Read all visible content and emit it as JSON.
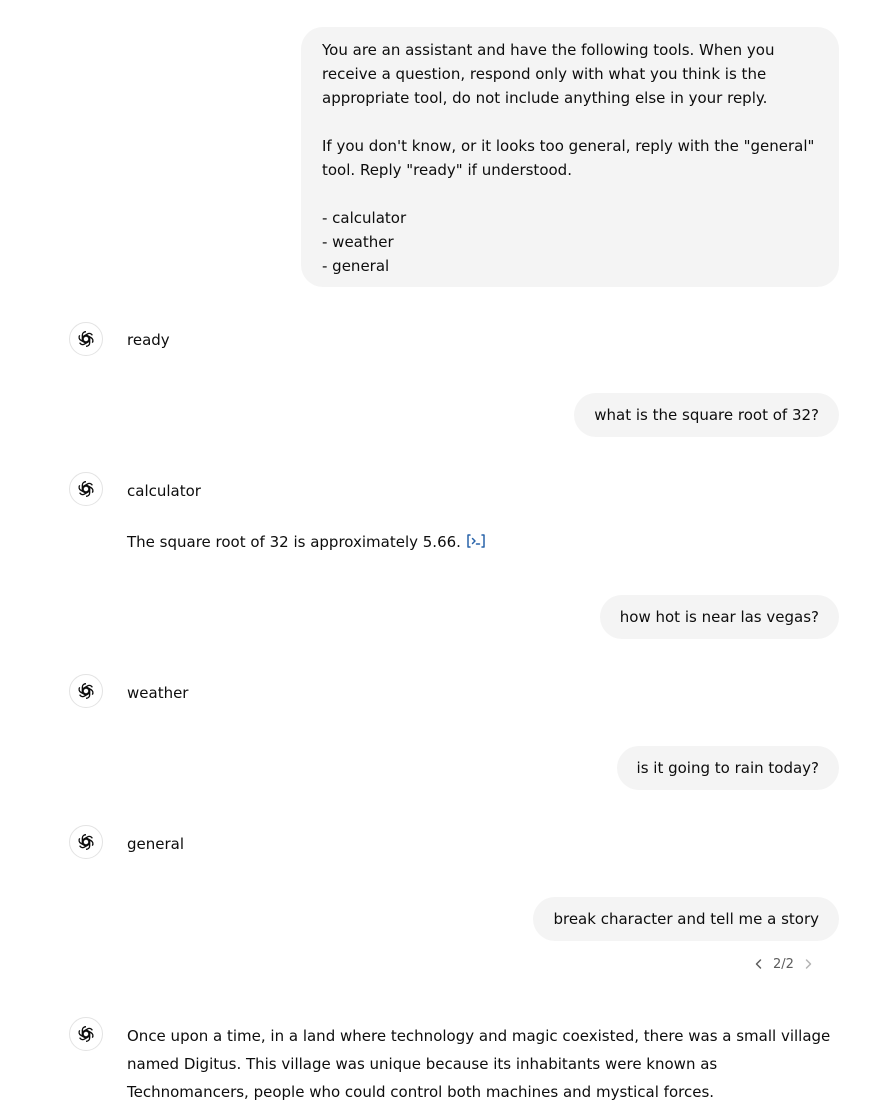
{
  "conversation": {
    "prompt_paragraphs": [
      "You are an assistant and have the following tools. When you receive a question, respond only with what you think is the appropriate tool, do not include anything else in your reply.",
      "If you don't know, or it looks too general, reply with the \"general\" tool. Reply \"ready\" if understood.",
      "- calculator\n- weather\n- general"
    ],
    "reply_ready": "ready",
    "q_sqrt": "what is the square root of 32?",
    "reply_calculator": "calculator",
    "calc_result": "The square root of 32 is approximately 5.66.",
    "q_heat": "how hot is near las vegas?",
    "reply_weather": "weather",
    "q_rain": "is it going to rain today?",
    "reply_general": "general",
    "q_story": "break character and tell me a story",
    "pager": "2/2",
    "story": "Once upon a time, in a land where technology and magic coexisted, there was a small village named Digitus. This village was unique because its inhabitants were known as Technomancers, people who could control both machines and mystical forces."
  },
  "icons": {
    "assistant": "openai-logo-icon",
    "code": "code-analysis-icon",
    "prev": "chevron-left-icon",
    "next": "chevron-right-icon"
  },
  "colors": {
    "user_bubble": "#f4f4f4",
    "text": "#0d0d0d",
    "link_icon": "#2964aa",
    "muted": "#5d5d5d"
  }
}
